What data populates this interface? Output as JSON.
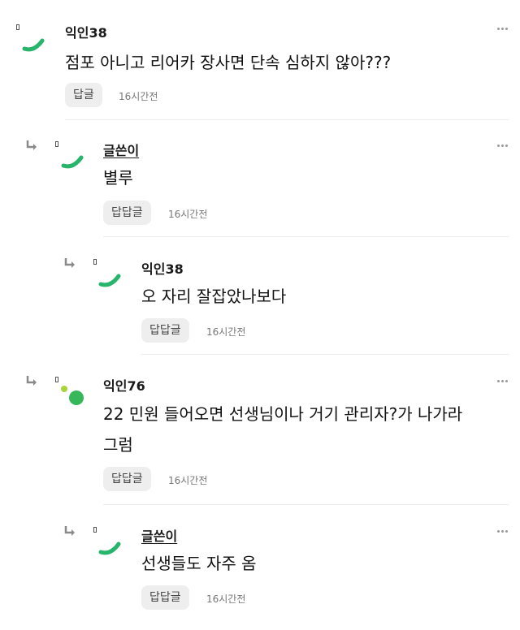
{
  "comments": [
    {
      "author": "익인38",
      "text": "점포 아니고 리어카 장사면 단속 심하지 않아???",
      "reply_label": "답글",
      "time": "16시간전"
    },
    {
      "author": "글쓴이",
      "text": "별루",
      "reply_label": "답답글",
      "time": "16시간전"
    },
    {
      "author": "익인38",
      "text": "오 자리 잘잡았나보다",
      "reply_label": "답답글",
      "time": "16시간전"
    },
    {
      "author": "익인76",
      "text_line1": "22 민원 들어오면 선생님이나 거기 관리자?가 나가라",
      "text_line2": "그럼",
      "reply_label": "답답글",
      "time": "16시간전"
    },
    {
      "author": "글쓴이",
      "text": "선생들도 자주 옴",
      "reply_label": "답답글",
      "time": "16시간전"
    }
  ],
  "colors": {
    "avatar_green": "#27b56c",
    "avatar_dot_green": "#36b85a",
    "avatar_dot_lime": "#a8d63a"
  },
  "icons": {
    "reply_arrow": "reply-arrow-icon",
    "more": "more-dots-icon"
  }
}
